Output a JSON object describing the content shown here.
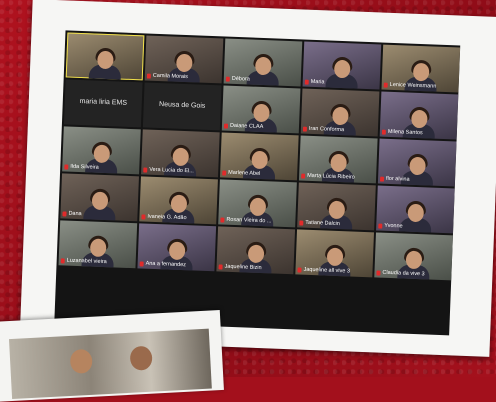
{
  "participants": [
    {
      "name": "",
      "cam": "v4",
      "active": true
    },
    {
      "name": "Camila Morais",
      "cam": "v1"
    },
    {
      "name": "Débora",
      "cam": "v2"
    },
    {
      "name": "Maria",
      "cam": "v3"
    },
    {
      "name": "Lenice Weinsmann",
      "cam": "v4"
    },
    {
      "name": "maria liria EMS",
      "off": true
    },
    {
      "name": "Neusa de Gois",
      "off": true
    },
    {
      "name": "Daiane CLAA",
      "cam": "v2"
    },
    {
      "name": "Iran Conforma",
      "cam": "v1"
    },
    {
      "name": "Milena Santos",
      "cam": "v3"
    },
    {
      "name": "Ilda Silveira",
      "cam": "v2"
    },
    {
      "name": "Vera Lucia do El...",
      "cam": "v1"
    },
    {
      "name": "Marlene Abel",
      "cam": "v4"
    },
    {
      "name": "Marta Lúcia Ribeiro",
      "cam": "v2"
    },
    {
      "name": "flor alvina",
      "cam": "v3"
    },
    {
      "name": "Dana",
      "cam": "v1"
    },
    {
      "name": "Ivaneia G. Adão",
      "cam": "v4"
    },
    {
      "name": "Rosan Vieira do ...",
      "cam": "v2"
    },
    {
      "name": "Tatiane Dalcin",
      "cam": "v1"
    },
    {
      "name": "Yvonne",
      "cam": "v3"
    },
    {
      "name": "Luzanabel vieira",
      "cam": "v2"
    },
    {
      "name": "Ana a fernandez",
      "cam": "v3"
    },
    {
      "name": "Jaqueline Bizin",
      "cam": "v1"
    },
    {
      "name": "Jaqueline all vive 3",
      "cam": "v4"
    },
    {
      "name": "Claudia da vive 3",
      "cam": "v2"
    }
  ]
}
